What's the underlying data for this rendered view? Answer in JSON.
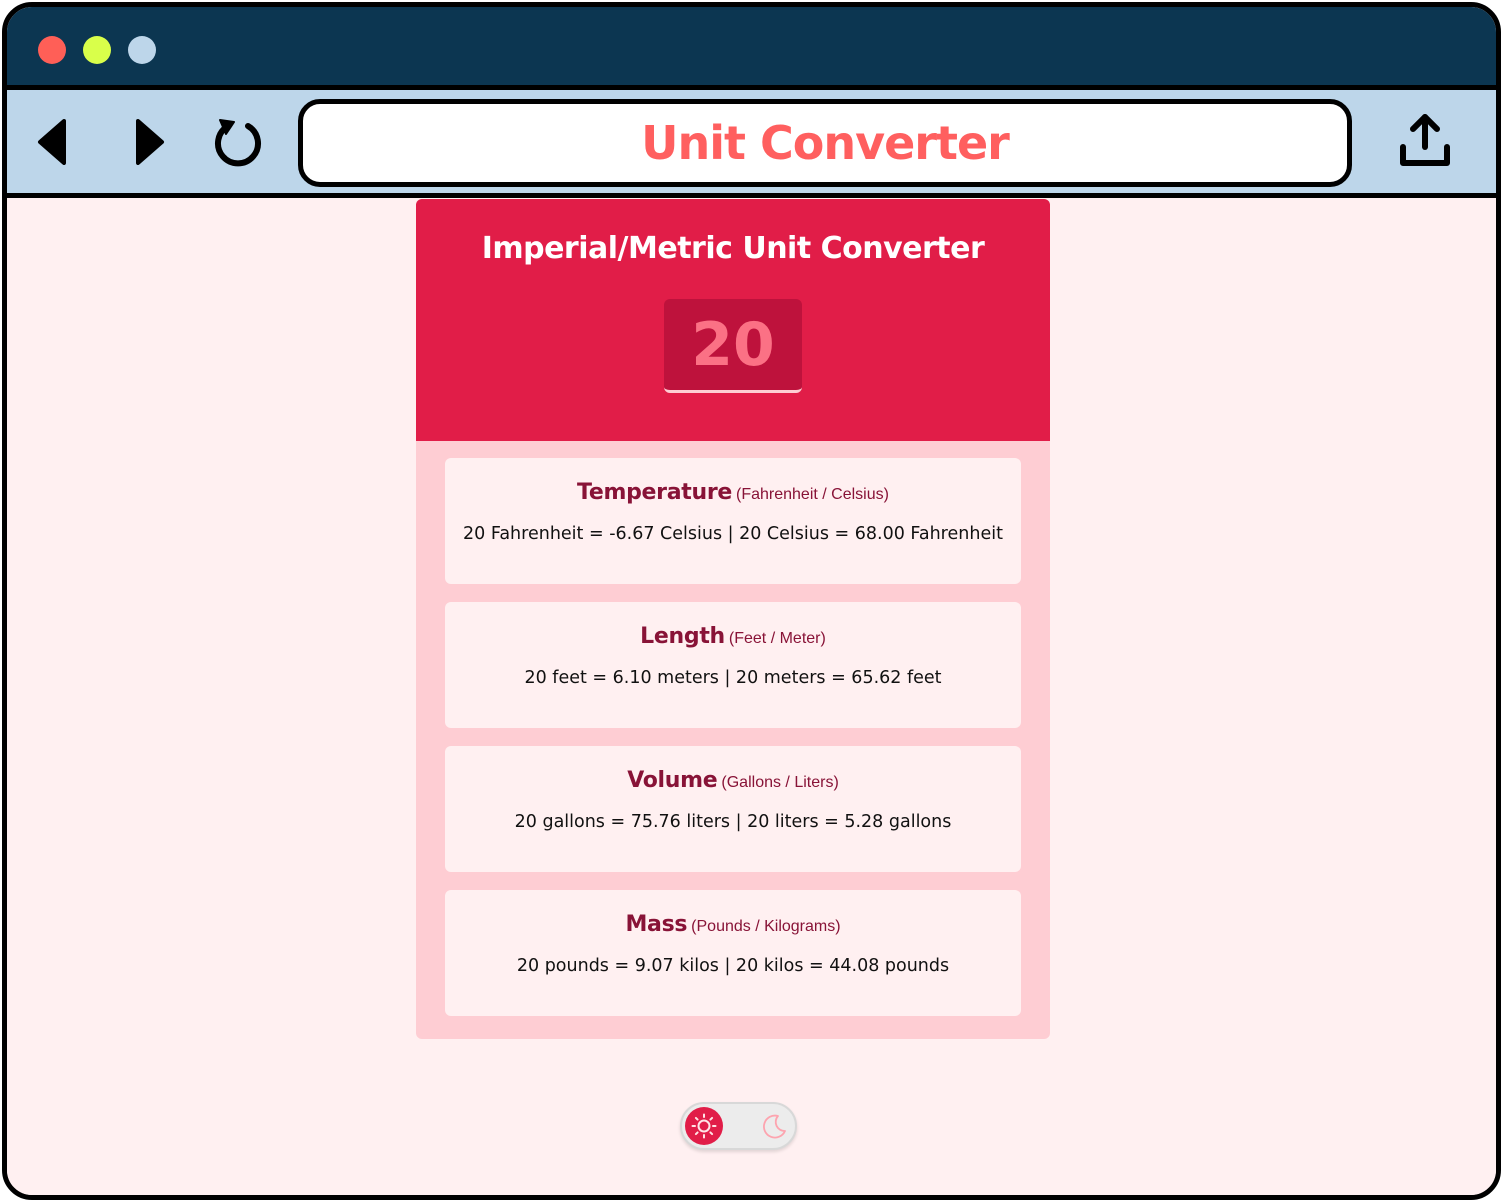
{
  "window": {
    "traffic_lights": [
      "close",
      "minimize",
      "zoom"
    ],
    "colors": {
      "titlebar": "#0c3651",
      "navbar": "#bdd6ea",
      "close": "#ff5f57",
      "minimize": "#d9ff4a",
      "zoom": "#bdd6ea"
    }
  },
  "toolbar": {
    "back_icon": "back-arrow-icon",
    "forward_icon": "forward-arrow-icon",
    "reload_icon": "reload-icon",
    "share_icon": "share-upload-icon",
    "address_text": "Unit Converter",
    "address_color": "#ff5f5f"
  },
  "converter": {
    "title": "Imperial/Metric Unit Converter",
    "input_value": "20",
    "accent_color": "#e11d48",
    "sections": [
      {
        "name": "Temperature",
        "units": "(Fahrenheit / Celsius)",
        "result": "20 Fahrenheit = -6.67 Celsius | 20 Celsius = 68.00 Fahrenheit"
      },
      {
        "name": "Length",
        "units": "(Feet / Meter)",
        "result": "20 feet = 6.10 meters | 20 meters = 65.62 feet"
      },
      {
        "name": "Volume",
        "units": "(Gallons / Liters)",
        "result": "20 gallons = 75.76 liters | 20 liters = 5.28 gallons"
      },
      {
        "name": "Mass",
        "units": "(Pounds / Kilograms)",
        "result": "20 pounds = 9.07 kilos | 20 kilos = 44.08 pounds"
      }
    ]
  },
  "theme_toggle": {
    "active": "light",
    "light_icon": "sun-icon",
    "dark_icon": "moon-icon"
  }
}
